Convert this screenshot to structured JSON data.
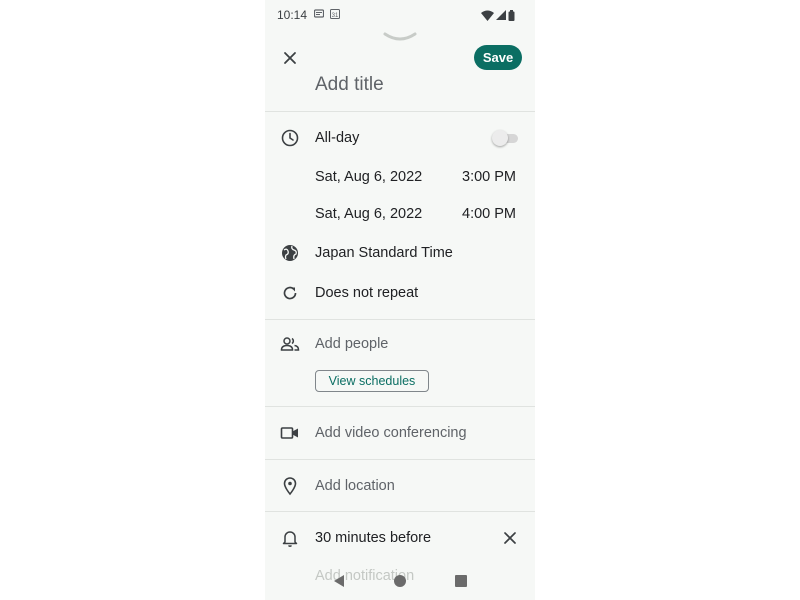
{
  "status_bar": {
    "time": "10:14",
    "icons": [
      "message-notification-icon",
      "calendar-notification-icon",
      "wifi-icon",
      "signal-icon",
      "battery-icon"
    ],
    "calendar_day": "31"
  },
  "header": {
    "save_label": "Save",
    "title_placeholder": "Add title"
  },
  "time_section": {
    "all_day_label": "All-day",
    "all_day_enabled": false,
    "start_date": "Sat, Aug 6, 2022",
    "start_time": "3:00 PM",
    "end_date": "Sat, Aug 6, 2022",
    "end_time": "4:00 PM",
    "timezone": "Japan Standard Time",
    "repeat": "Does not repeat"
  },
  "people_section": {
    "add_people_label": "Add people",
    "view_schedules_label": "View schedules"
  },
  "video_section": {
    "label": "Add video conferencing"
  },
  "location_section": {
    "label": "Add location"
  },
  "notification_section": {
    "reminder": "30 minutes before",
    "add_notification_label": "Add notification"
  },
  "colors": {
    "accent": "#0b6e63",
    "background": "#f6f8f6",
    "divider": "#e0e3e0",
    "muted_text": "#5f6368"
  }
}
